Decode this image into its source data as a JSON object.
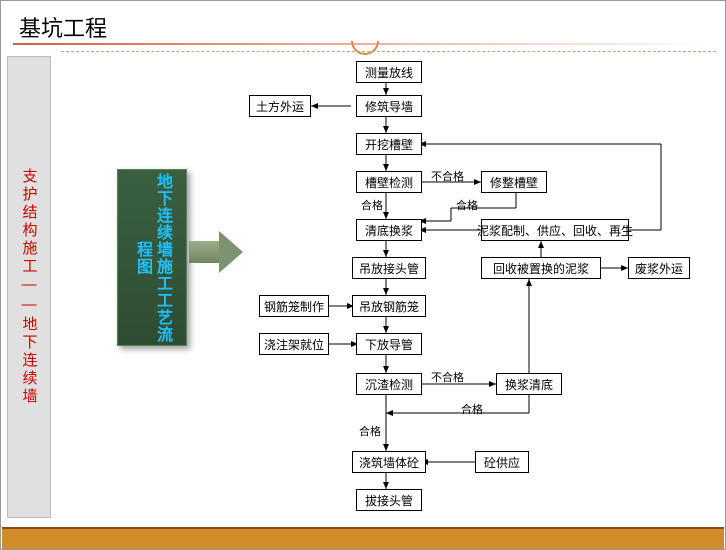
{
  "title": "基坑工程",
  "sidebar_label": "支护结构施工——地下连续墙",
  "panel_label": "地下连续墙施工工艺流程图",
  "nodes": {
    "n1": "测量放线",
    "n2": "修筑导墙",
    "n3": "土方外运",
    "n4": "开挖槽壁",
    "n5": "槽壁检测",
    "n6": "修整槽壁",
    "n7": "清底换浆",
    "n8": "泥浆配制、供应、回收、再生",
    "n9": "回收被置换的泥浆",
    "n10": "废浆外运",
    "n11": "吊放接头管",
    "n12": "钢筋笼制作",
    "n13": "吊放钢筋笼",
    "n14": "浇注架就位",
    "n15": "下放导管",
    "n16": "沉渣检测",
    "n17": "换浆清底",
    "n18": "浇筑墙体砼",
    "n19": "砼供应",
    "n20": "拔接头管"
  },
  "labels": {
    "fail1": "不合格",
    "pass1a": "合格",
    "pass1b": "合格",
    "fail2": "不合格",
    "pass2a": "合格",
    "pass2b": "合格"
  }
}
